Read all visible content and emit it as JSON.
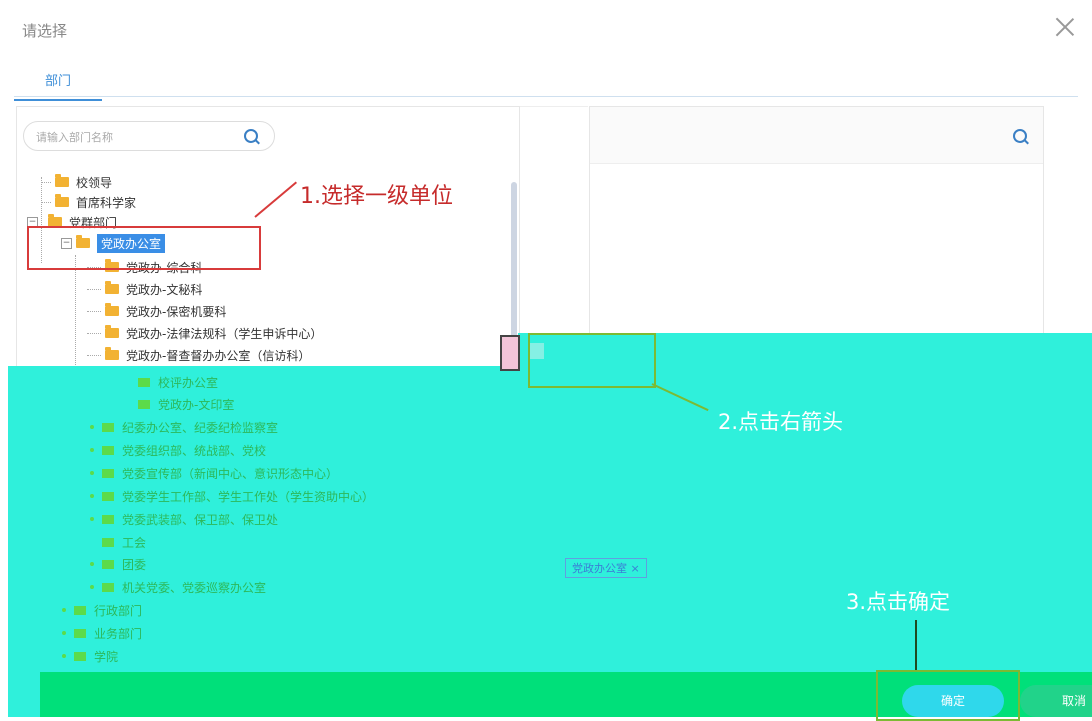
{
  "dialog": {
    "title": "请选择"
  },
  "tabs": [
    {
      "label": "部门"
    }
  ],
  "search": {
    "placeholder": "请输入部门名称"
  },
  "tree": {
    "top_items": [
      {
        "label": "校领导"
      },
      {
        "label": "首席科学家"
      },
      {
        "label": "党群部门"
      }
    ],
    "selected": "党政办公室",
    "children": [
      {
        "label": "党政办-综合科"
      },
      {
        "label": "党政办-文秘科"
      },
      {
        "label": "党政办-保密机要科"
      },
      {
        "label": "党政办-法律法规科（学生申诉中心）"
      },
      {
        "label": "党政办-督查督办办公室（信访科）"
      }
    ],
    "faded_children": [
      {
        "label": "校评办公室"
      },
      {
        "label": "党政办-文印室"
      }
    ],
    "faded_siblings": [
      {
        "label": "纪委办公室、纪委纪检监察室"
      },
      {
        "label": "党委组织部、统战部、党校"
      },
      {
        "label": "党委宣传部（新闻中心、意识形态中心）"
      },
      {
        "label": "党委学生工作部、学生工作处（学生资助中心）"
      },
      {
        "label": "党委武装部、保卫部、保卫处"
      },
      {
        "label": "工会"
      },
      {
        "label": "团委"
      },
      {
        "label": "机关党委、党委巡察办公室"
      }
    ],
    "faded_top": [
      {
        "label": "行政部门"
      },
      {
        "label": "业务部门"
      },
      {
        "label": "学院"
      }
    ]
  },
  "right_panel": {
    "selected_item": "党政办公室 ×"
  },
  "annotations": {
    "step1": "1.选择一级单位",
    "step2": "2.点击右箭头",
    "step3": "3.点击确定"
  },
  "buttons": {
    "confirm": "确定",
    "cancel": "取消"
  },
  "colors": {
    "accent": "#3a8ee6",
    "annotation_red": "#c62b2b",
    "annotation_green": "#7cba33",
    "overlay_cyan": "#2ff0db",
    "overlay_green": "#00e07a"
  }
}
